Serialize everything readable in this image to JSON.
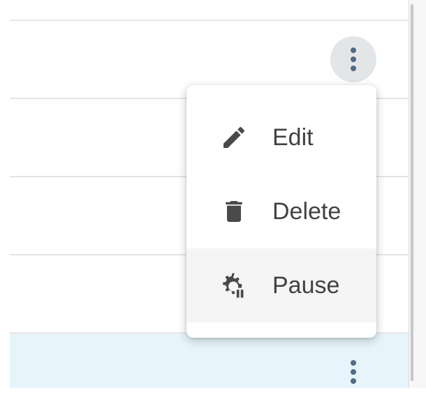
{
  "row_actions": {
    "more_icon": "more-vertical-icon"
  },
  "context_menu": {
    "items": [
      {
        "label": "Edit",
        "icon": "pencil-icon"
      },
      {
        "label": "Delete",
        "icon": "trash-icon"
      },
      {
        "label": "Pause",
        "icon": "gear-pause-icon"
      }
    ],
    "hovered_item": "Pause"
  },
  "colors": {
    "selected_row": "#e8f4fc",
    "menu_text": "#424242",
    "icon": "#4a4a4a",
    "kebab_dots": "#4f6b85"
  }
}
